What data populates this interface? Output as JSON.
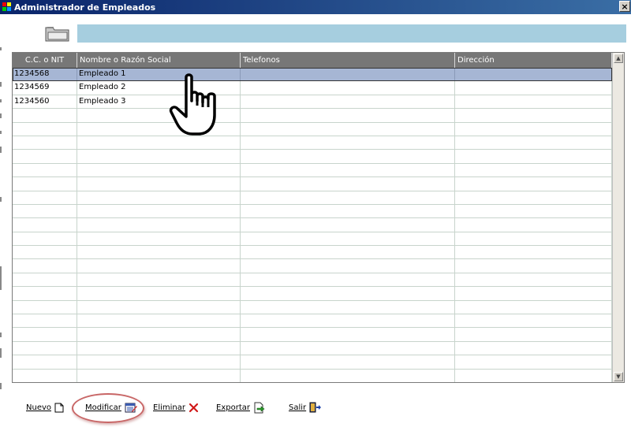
{
  "window": {
    "title": "Administrador de Empleados",
    "close_glyph": "×"
  },
  "grid": {
    "columns": [
      "C.C. o NIT",
      "Nombre o Razón Social",
      "Telefonos",
      "Dirección"
    ],
    "rows": [
      {
        "id": "1234568",
        "name": "Empleado 1",
        "phone": "",
        "address": ""
      },
      {
        "id": "1234569",
        "name": "Empleado 2",
        "phone": "",
        "address": ""
      },
      {
        "id": "1234560",
        "name": "Empleado 3",
        "phone": "",
        "address": ""
      }
    ],
    "selected_row": 0
  },
  "toolbar": {
    "nuevo": "Nuevo",
    "modificar": "Modificar",
    "eliminar": "Eliminar",
    "exportar": "Exportar",
    "salir": "Salir"
  },
  "icons": {
    "app": "app-icon",
    "folder": "folder-icon",
    "cursor": "hand-pointer-icon",
    "nuevo": "new-document-icon",
    "modificar": "edit-calendar-icon",
    "eliminar": "red-x-icon",
    "exportar": "export-document-icon",
    "salir": "exit-door-icon"
  },
  "colors": {
    "titlebar": "#0a246a",
    "header_bar": "#a6cedf",
    "grid_header": "#777777",
    "selected_row": "#a6b6d4",
    "highlight_oval": "#c86666"
  }
}
